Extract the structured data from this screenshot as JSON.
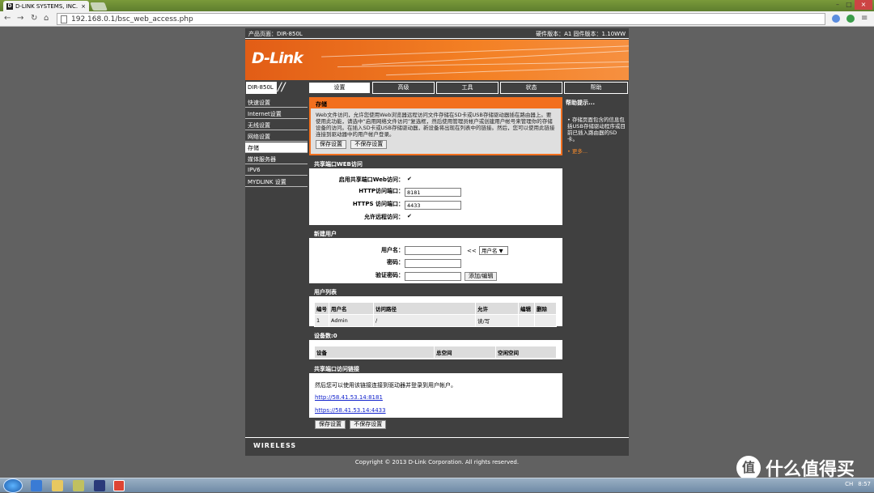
{
  "browser": {
    "tab_title": "D-LINK SYSTEMS, INC.",
    "tab_close": "×",
    "url": "192.168.0.1/bsc_web_access.php"
  },
  "router": {
    "product_page": "产品页面：DIR-850L",
    "hw_fw": "硬件版本：A1   固件版本：1.10WW",
    "logo": "D-Link",
    "model": "DIR-850L",
    "tabs": [
      "设置",
      "高级",
      "工具",
      "状态",
      "帮助"
    ],
    "sidebar": [
      "快速设置",
      "Internet设置",
      "无线设置",
      "网络设置",
      "存储",
      "媒体服务器",
      "IPV6",
      "MYDLINK 设置"
    ],
    "storage": {
      "title": "存储",
      "desc": "Web文件访问，允许您使用Web浏览器远程访问文件存储在SD卡或USB存储驱动器插在路由器上。要使用此功能，请选中“启用网络文件访问”复选框，然后使用管理员帐户或创建用户帐号来管理你的存储设备的访问。在插入SD卡或USB存储驱动器，新设备将出现在列表中的链接。然后，您可以使用此链接连接到驱动器中的用户帐户登录。",
      "save": "保存设置",
      "nosave": "不保存设置"
    },
    "web_access": {
      "title": "共享端口WEB访问",
      "enable_label": "启用共享端口Web访问：",
      "http_label": "HTTP访问端口：",
      "http_value": "8181",
      "https_label": "HTTPS 访问端口：",
      "https_value": "4433",
      "remote_label": "允许远程访问：",
      "check": "✔"
    },
    "new_user": {
      "title": "新建用户",
      "username_label": "用户名：",
      "password_label": "密码：",
      "confirm_label": "验证密码：",
      "arrow": "<<",
      "select_value": "用户名",
      "add_button": "添加/编辑"
    },
    "user_list": {
      "title": "用户列表",
      "headers": [
        "编号",
        "用户名",
        "访问路径",
        "允许",
        "编辑",
        "删除"
      ],
      "row": [
        "1",
        "Admin",
        "/",
        "读/写",
        "",
        ""
      ]
    },
    "devices": {
      "title": "设备数:0",
      "headers": [
        "设备",
        "总空间",
        "空闲空间"
      ]
    },
    "links": {
      "title": "共享端口访问链接",
      "desc": "然后您可以使用该链接连接到驱动器并登录到用户帐户。",
      "http": "http://58.41.53.14:8181",
      "https": "https://58.41.53.14:4433"
    },
    "bottom_save": "保存设置",
    "bottom_nosave": "不保存设置",
    "help": {
      "title": "帮助提示...",
      "bullet": "存储页面包含的信息包括USB存储驱动程序或目前已插入路由器的SD卡。",
      "more": "更多..."
    },
    "footer_brand": "WIRELESS",
    "copyright": "Copyright © 2013 D-Link Corporation. All rights reserved."
  },
  "taskbar": {
    "clock": "8:57",
    "lang": "CH"
  },
  "watermark": {
    "icon": "值",
    "text": "什么值得买"
  }
}
